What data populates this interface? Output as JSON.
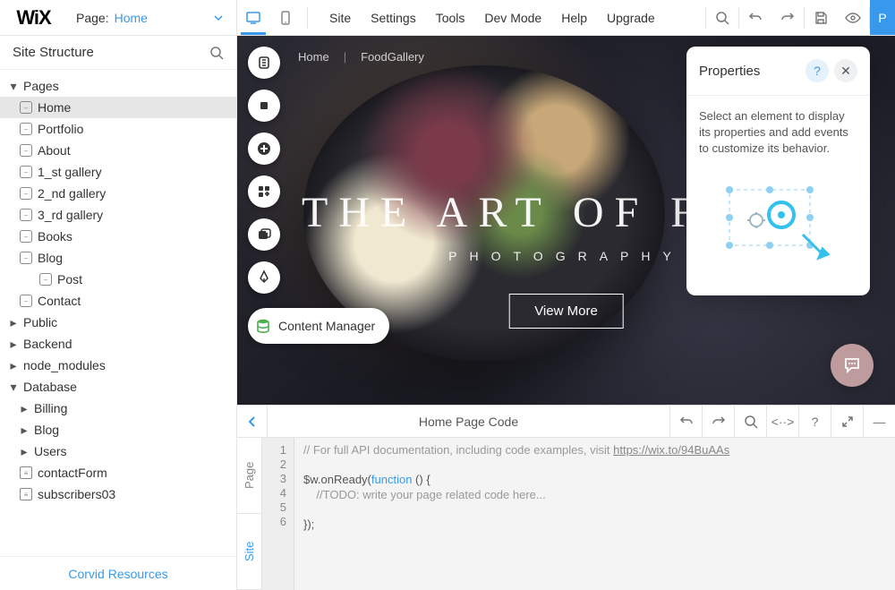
{
  "topbar": {
    "logo": "WiX",
    "page_label": "Page:",
    "current_page": "Home",
    "menu": [
      "Site",
      "Settings",
      "Tools",
      "Dev Mode",
      "Help",
      "Upgrade"
    ]
  },
  "sidebar": {
    "title": "Site Structure",
    "pages_label": "Pages",
    "pages": [
      "Home",
      "Portfolio",
      "About",
      "1_st gallery",
      "2_nd gallery",
      "3_rd gallery",
      "Books",
      "Blog"
    ],
    "blog_children": [
      "Post"
    ],
    "after_blog": [
      "Contact"
    ],
    "folders": [
      "Public",
      "Backend",
      "node_modules"
    ],
    "database_label": "Database",
    "database_items": [
      "Billing",
      "Blog",
      "Users"
    ],
    "collections": [
      "contactForm",
      "subscribers03"
    ],
    "footer": "Corvid Resources"
  },
  "stage": {
    "breadcrumb": [
      "Home",
      "FoodGallery"
    ],
    "headline": "THE ART OF FOOD",
    "subhead": "PHOTOGRAPHY",
    "cta": "View More",
    "content_manager": "Content Manager"
  },
  "panel": {
    "title": "Properties",
    "text": "Select an element to display its properties and add events to customize its behavior."
  },
  "code": {
    "title": "Home Page Code",
    "tabs": [
      "Page",
      "Site"
    ],
    "lines": [
      "1",
      "2",
      "3",
      "4",
      "5",
      "6"
    ],
    "c1a": "// For full API documentation, including code examples, visit ",
    "c1b": "https://wix.to/94BuAAs",
    "c3a": "$w.onReady(",
    "c3b": "function",
    "c3c": " () {",
    "c4": "    //TODO: write your page related code here...",
    "c6": "});"
  }
}
